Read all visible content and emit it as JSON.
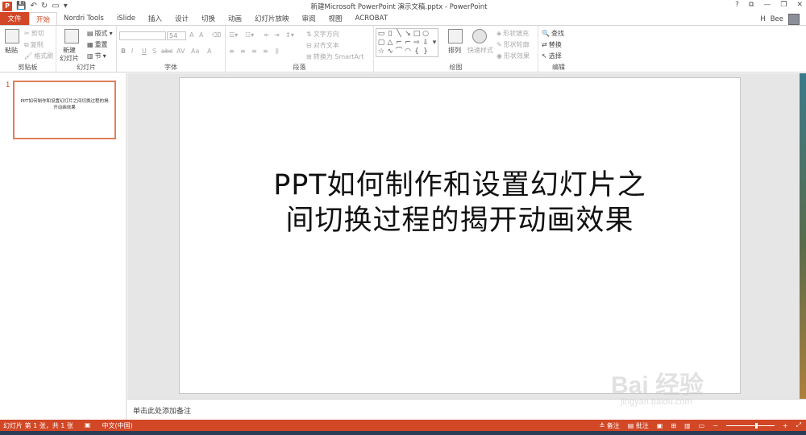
{
  "window": {
    "title": "新建Microsoft PowerPoint 演示文稿.pptx - PowerPoint",
    "app_logo": "P",
    "controls": [
      "?",
      "⧉",
      "—",
      "❐",
      "✕"
    ]
  },
  "tabs": [
    {
      "label": "文件",
      "kind": "file"
    },
    {
      "label": "开始",
      "kind": "active"
    },
    {
      "label": "Nordri Tools",
      "kind": "normal"
    },
    {
      "label": "iSlide",
      "kind": "normal"
    },
    {
      "label": "插入",
      "kind": "normal"
    },
    {
      "label": "设计",
      "kind": "normal"
    },
    {
      "label": "切换",
      "kind": "normal"
    },
    {
      "label": "动画",
      "kind": "normal"
    },
    {
      "label": "幻灯片放映",
      "kind": "normal"
    },
    {
      "label": "审阅",
      "kind": "normal"
    },
    {
      "label": "视图",
      "kind": "normal"
    },
    {
      "label": "ACROBAT",
      "kind": "normal"
    }
  ],
  "account": {
    "user_prefix": "H",
    "user_name": "Bee"
  },
  "ribbon": {
    "clipboard": {
      "label": "剪贴板",
      "paste": "粘贴",
      "cut": "剪切",
      "copy": "复制",
      "format_painter": "格式刷"
    },
    "slides": {
      "label": "幻灯片",
      "new_slide_1": "新建",
      "new_slide_2": "幻灯片",
      "layout": "版式",
      "reset": "重置",
      "section": "节"
    },
    "font": {
      "label": "字体",
      "font_name": "",
      "font_size": "54",
      "bold": "B",
      "italic": "I",
      "underline": "U",
      "strike": "S",
      "abc": "abc",
      "spacing": "AV",
      "case": "Aa",
      "grow": "A",
      "shrink": "A"
    },
    "paragraph": {
      "label": "段落",
      "text_direction": "文字方向",
      "align_text": "对齐文本",
      "smartart": "转换为 SmartArt"
    },
    "drawing": {
      "label": "绘图",
      "arrange": "排列",
      "quick_styles": "快速样式",
      "shape_fill": "形状填充",
      "shape_outline": "形状轮廓",
      "shape_effects": "形状效果"
    },
    "editing": {
      "label": "编辑",
      "find": "查找",
      "replace": "替换",
      "select": "选择"
    }
  },
  "thumbnail": {
    "number": "1",
    "title": "PPT如何制作和设置幻灯片之间切换过程的揭开动画效果"
  },
  "slide": {
    "title_line1": "PPT如何制作和设置幻灯片之",
    "title_line2": "间切换过程的揭开动画效果"
  },
  "notes": {
    "placeholder": "单击此处添加备注"
  },
  "status": {
    "slide_info": "幻灯片 第 1 张，共 1 张",
    "language": "中文(中国)",
    "notes_btn": "备注",
    "comments_btn": "批注",
    "zoom_minus": "−",
    "zoom_plus": "+"
  },
  "watermark": {
    "main": "Bai 经验",
    "sub": "jingyan.baidu.com"
  },
  "colors": {
    "accent": "#d24726",
    "thumb_border": "#e07f5c",
    "canvas_bg": "#e6e6e6"
  }
}
